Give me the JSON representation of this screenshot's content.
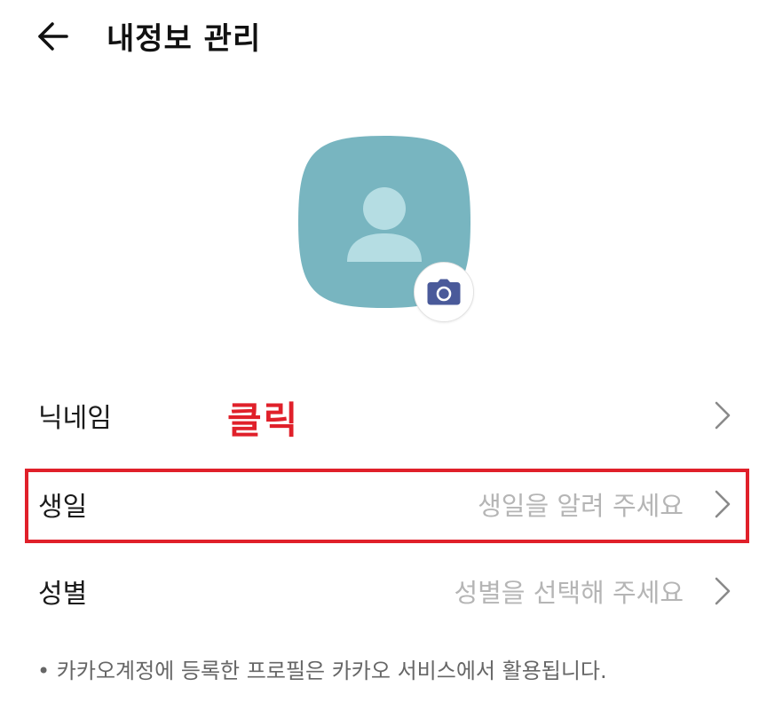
{
  "header": {
    "title": "내정보 관리",
    "back_icon": "arrow-left-icon"
  },
  "profile": {
    "avatar_icon": "default-user-icon",
    "avatar_color": "#78b5c0",
    "camera_icon": "camera-icon",
    "camera_color": "#4a5a9a"
  },
  "rows": [
    {
      "label": "닉네임",
      "value": ""
    },
    {
      "label": "생일",
      "value": "생일을 알려 주세요"
    },
    {
      "label": "성별",
      "value": "성별을 선택해 주세요"
    }
  ],
  "annotation": {
    "text": "클릭",
    "color": "#e0202a"
  },
  "footnote": "• 카카오계정에 등록한 프로필은 카카오 서비스에서 활용됩니다."
}
